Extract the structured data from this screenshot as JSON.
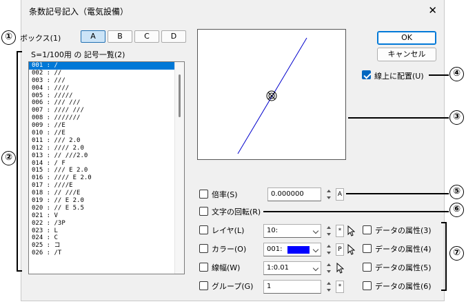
{
  "window": {
    "title": "条数記号記入（電気設備）",
    "close_glyph": "✕"
  },
  "annotations": [
    "①",
    "②",
    "③",
    "④",
    "⑤",
    "⑥",
    "⑦"
  ],
  "box": {
    "label": "ボックス(1)",
    "tabs": [
      "A",
      "B",
      "C",
      "D"
    ]
  },
  "symbol_list": {
    "label": "S=1/100用 の 記号一覧(2)",
    "items": [
      "001 : /",
      "002 : //",
      "003 : ///",
      "004 : ////",
      "005 : /////",
      "006 : /// ///",
      "007 : //// ///",
      "008 : ///////",
      "009 : //E",
      "010 : //E",
      "011 : /// 2.0",
      "012 : //// 2.0",
      "013 : // ///2.0",
      "014 : / F",
      "015 : /// E 2.0",
      "016 : //// E 2.0",
      "017 : ////E",
      "018 : // ///E",
      "019 : // E 2.0",
      "020 : // E 5.5",
      "021 : V",
      "022 : /3P",
      "023 : L",
      "024 : C",
      "025 : コ",
      "026 : /T"
    ]
  },
  "buttons": {
    "ok": "OK",
    "cancel": "キャンセル"
  },
  "on_line": {
    "label": "線上に配置(U)",
    "checked": true
  },
  "scale": {
    "label": "倍率(S)",
    "value": "0.000000",
    "btn": "A"
  },
  "rotate": {
    "label": "文字の回転(R)"
  },
  "layer": {
    "label": "レイヤ(L)",
    "value": "10:",
    "btn": "*"
  },
  "color": {
    "label": "カラー(O)",
    "value": "001:",
    "btn": "P",
    "swatch": "#0000ff"
  },
  "linewidth": {
    "label": "線幅(W)",
    "value": "1:0.01"
  },
  "group": {
    "label": "グループ(G)",
    "value": "1",
    "btn": "*"
  },
  "attributes": [
    "データの属性(3)",
    "データの属性(4)",
    "データの属性(5)",
    "データの属性(6)"
  ]
}
